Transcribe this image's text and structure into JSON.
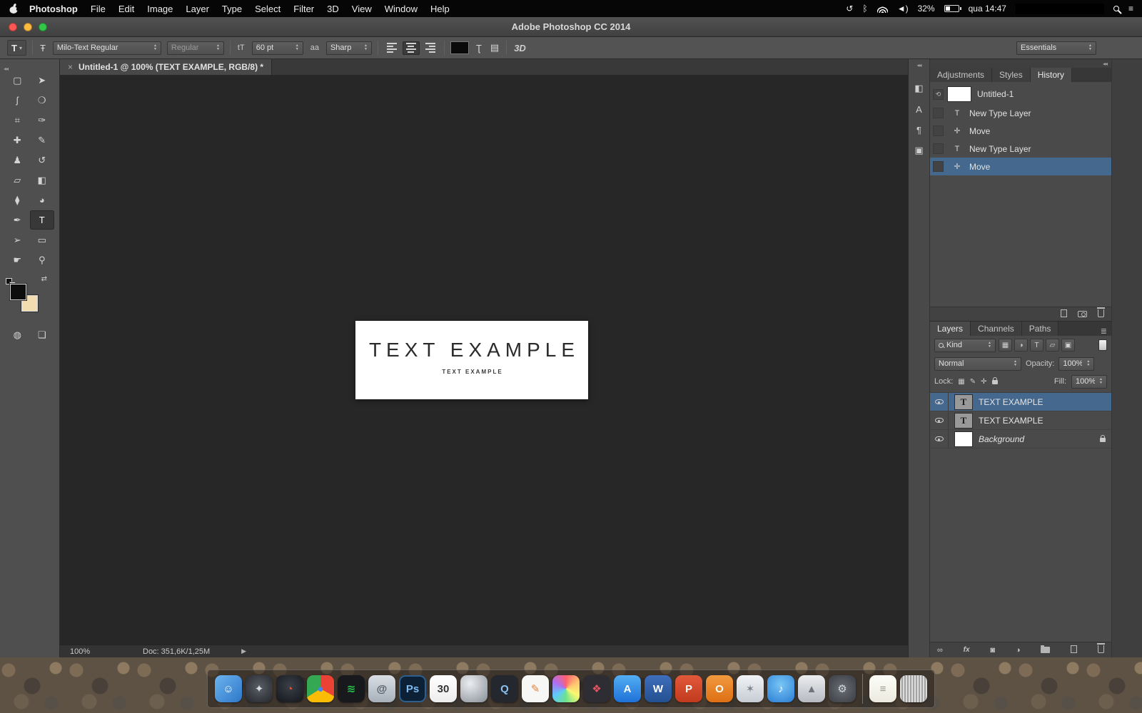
{
  "menubar": {
    "items": [
      {
        "label": "Photoshop",
        "bold": true
      },
      {
        "label": "File"
      },
      {
        "label": "Edit"
      },
      {
        "label": "Image"
      },
      {
        "label": "Layer"
      },
      {
        "label": "Type"
      },
      {
        "label": "Select"
      },
      {
        "label": "Filter"
      },
      {
        "label": "3D"
      },
      {
        "label": "View"
      },
      {
        "label": "Window"
      },
      {
        "label": "Help"
      }
    ],
    "icons": {
      "time_machine": "↺",
      "bluetooth": "ᛒ",
      "volume": "◄)",
      "notification": "≡"
    },
    "battery_percent": "32%",
    "clock": "qua 14:47"
  },
  "titlebar": {
    "title": "Adobe Photoshop CC 2014"
  },
  "options_bar": {
    "tool_glyph": "T",
    "orientation_glyph": "Ŧ",
    "font_family": "Milo-Text Regular",
    "font_style": "Regular",
    "size_icon": "tT",
    "font_size": "60 pt",
    "aa_icon": "aa",
    "anti_alias": "Sharp",
    "warp_glyph": "Ʈ",
    "panels_glyph": "▤",
    "threed_label": "3D",
    "workspace": "Essentials"
  },
  "toolbar": {
    "collapse_glyph": "◂◂",
    "foreground_color": "#0d0d0d",
    "background_color": "#f2ddb0",
    "swap_glyph": "⇄",
    "tools": [
      {
        "name": "rectangular-marquee-tool",
        "glyph": "▢"
      },
      {
        "name": "move-tool",
        "glyph": "➤"
      },
      {
        "name": "lasso-tool",
        "glyph": "ʃ"
      },
      {
        "name": "quick-selection-tool",
        "glyph": "❍"
      },
      {
        "name": "crop-tool",
        "glyph": "⌗"
      },
      {
        "name": "eyedropper-tool",
        "glyph": "✑"
      },
      {
        "name": "healing-brush-tool",
        "glyph": "✚"
      },
      {
        "name": "brush-tool",
        "glyph": "✎"
      },
      {
        "name": "clone-stamp-tool",
        "glyph": "♟"
      },
      {
        "name": "history-brush-tool",
        "glyph": "↺"
      },
      {
        "name": "eraser-tool",
        "glyph": "▱"
      },
      {
        "name": "gradient-tool",
        "glyph": "◧"
      },
      {
        "name": "blur-tool",
        "glyph": "⧫"
      },
      {
        "name": "dodge-tool",
        "glyph": "◕"
      },
      {
        "name": "pen-tool",
        "glyph": "✒"
      },
      {
        "name": "type-tool",
        "glyph": "T",
        "selected": true
      },
      {
        "name": "path-selection-tool",
        "glyph": "➢"
      },
      {
        "name": "rectangle-tool",
        "glyph": "▭"
      },
      {
        "name": "hand-tool",
        "glyph": "☛"
      },
      {
        "name": "zoom-tool",
        "glyph": "⚲"
      }
    ],
    "bottom_tools": [
      {
        "name": "quick-mask-mode-button",
        "glyph": "◍"
      },
      {
        "name": "screen-mode-button",
        "glyph": "❏"
      }
    ]
  },
  "document_tab": {
    "close_glyph": "×",
    "title": "Untitled-1 @ 100% (TEXT EXAMPLE, RGB/8) *"
  },
  "canvas": {
    "heading": "TEXT EXAMPLE",
    "subheading": "TEXT EXAMPLE"
  },
  "status_bar": {
    "zoom": "100%",
    "doc_info": "Doc: 351,6K/1,25M",
    "arrow": "▶"
  },
  "panel_strip": {
    "collapse_glyph": "◂◂",
    "icons": [
      {
        "name": "adjustments-panel-icon",
        "glyph": "◧"
      },
      {
        "name": "character-panel-icon",
        "glyph": "A"
      },
      {
        "name": "paragraph-panel-icon",
        "glyph": "¶"
      },
      {
        "name": "3d-panel-icon",
        "glyph": "▣"
      }
    ]
  },
  "history_panel": {
    "tabs": [
      {
        "label": "Adjustments"
      },
      {
        "label": "Styles"
      },
      {
        "label": "History",
        "active": true
      }
    ],
    "menu_glyph": "≣",
    "snapshot": {
      "label": "Untitled-1",
      "source_glyph": "⟲"
    },
    "items": [
      {
        "label": "New Type Layer",
        "glyph": "T"
      },
      {
        "label": "Move",
        "glyph": "✛"
      },
      {
        "label": "New Type Layer",
        "glyph": "T"
      },
      {
        "label": "Move",
        "glyph": "✛",
        "selected": true
      }
    ]
  },
  "layers_panel": {
    "tabs": [
      {
        "label": "Layers",
        "active": true
      },
      {
        "label": "Channels"
      },
      {
        "label": "Paths"
      }
    ],
    "menu_glyph": "≣",
    "kind_label": "Kind",
    "filter_icons": [
      {
        "name": "filter-pixel-layers-icon",
        "glyph": "▦"
      },
      {
        "name": "filter-adjustment-layers-icon",
        "glyph": "◑"
      },
      {
        "name": "filter-type-layers-icon",
        "glyph": "T"
      },
      {
        "name": "filter-shape-layers-icon",
        "glyph": "▱"
      },
      {
        "name": "filter-smart-objects-icon",
        "glyph": "▣"
      }
    ],
    "blend_mode": "Normal",
    "opacity_label": "Opacity:",
    "opacity_value": "100%",
    "lock_label": "Lock:",
    "lock_icons": {
      "transparent": "▦",
      "paint": "✎",
      "position": "✛"
    },
    "fill_label": "Fill:",
    "fill_value": "100%",
    "fx_label": "fx",
    "adjustment_glyph": "◑",
    "layers": [
      {
        "name": "TEXT EXAMPLE",
        "thumb": "T",
        "selected": true
      },
      {
        "name": "TEXT EXAMPLE",
        "thumb": "T"
      },
      {
        "name": "Background",
        "thumb": "",
        "white_thumb": true,
        "italic": true,
        "locked": true
      }
    ]
  },
  "colors": {
    "selection_highlight": "#44688e",
    "canvas_background": "#272727"
  },
  "dock": {
    "apps": [
      {
        "name": "finder",
        "glyph": "☺",
        "bg": "linear-gradient(135deg,#6db3ef,#2d77c8)",
        "fg": "#ffffff"
      },
      {
        "name": "launchpad",
        "glyph": "✦",
        "bg": "radial-gradient(circle at 50% 45%,#5a5e66,#23262b)",
        "fg": "#d9dde3"
      },
      {
        "name": "dashboard",
        "glyph": "◔",
        "bg": "radial-gradient(circle at 50% 40%,#3a3f49,#14161a)",
        "fg": "#e05545"
      },
      {
        "name": "chrome",
        "glyph": "●",
        "bg": "conic-gradient(#ea4335 0 33%,#fbbc05 33% 66%,#34a853 66% 100%)",
        "fg": "#4285f4"
      },
      {
        "name": "spotify",
        "glyph": "≋",
        "bg": "#17191d",
        "fg": "#27c04a"
      },
      {
        "name": "mail",
        "glyph": "@",
        "bg": "linear-gradient(#d9dee4,#a7b0ba)",
        "fg": "#4e5963"
      },
      {
        "name": "photoshop",
        "glyph": "Ps",
        "bg": "#0c2136",
        "fg": "#7fbcf0",
        "shadow": "inset 0 0 0 2px #2e5f8f"
      },
      {
        "name": "calendar",
        "glyph": "30",
        "bg": "linear-gradient(#ffffff,#ededed)",
        "fg": "#333333"
      },
      {
        "name": "firefox",
        "glyph": "",
        "bg": "radial-gradient(circle at 35% 30%,#eceef0,#878e97)",
        "fg": "#ffffff"
      },
      {
        "name": "quicktime",
        "glyph": "Q",
        "bg": "#24272d",
        "fg": "#8cc0f0"
      },
      {
        "name": "pages",
        "glyph": "✎",
        "bg": "#f7f7f5",
        "fg": "#e8813a"
      },
      {
        "name": "photos",
        "glyph": "",
        "bg": "conic-gradient(#ff5f6d,#ffc371,#f9f871,#6ce38b,#5fc9f8,#b06ef0,#ff5f6d)",
        "fg": "#ffffff"
      },
      {
        "name": "pixelmator",
        "glyph": "❖",
        "bg": "#2d2d33",
        "fg": "#e25560"
      },
      {
        "name": "app-store",
        "glyph": "A",
        "bg": "linear-gradient(#53aef2,#1f71d8)",
        "fg": "#ffffff"
      },
      {
        "name": "word",
        "glyph": "W",
        "bg": "linear-gradient(#3f6ebc,#23508f)",
        "fg": "#ffffff"
      },
      {
        "name": "powerpoint",
        "glyph": "P",
        "bg": "linear-gradient(#e2593a,#c13a1e)",
        "fg": "#ffffff"
      },
      {
        "name": "office",
        "glyph": "O",
        "bg": "linear-gradient(#f29a3e,#de6f14)",
        "fg": "#ffffff"
      },
      {
        "name": "itunes-store",
        "glyph": "✶",
        "bg": "linear-gradient(#f2f4f6,#c6ccd4)",
        "fg": "#7c8490"
      },
      {
        "name": "itunes",
        "glyph": "♪",
        "bg": "radial-gradient(circle at 50% 35%,#79c5f6,#2a7ed3)",
        "fg": "#ffffff"
      },
      {
        "name": "rocket-app",
        "glyph": "▲",
        "bg": "linear-gradient(#ecedef,#b6bac1)",
        "fg": "#70757d"
      },
      {
        "name": "system-preferences",
        "glyph": "⚙",
        "bg": "radial-gradient(circle,#6a6e75,#3a3d43)",
        "fg": "#d2d5da"
      }
    ],
    "extras": [
      {
        "name": "textedit",
        "glyph": "≡",
        "bg": "linear-gradient(#fdfdf9,#eceadf)",
        "fg": "#9a978b"
      },
      {
        "name": "trash",
        "glyph": "",
        "bg": "repeating-linear-gradient(90deg,#dcdcdc 0 2px,#a3a3a3 2px 4px)",
        "fg": "#ffffff"
      }
    ]
  }
}
